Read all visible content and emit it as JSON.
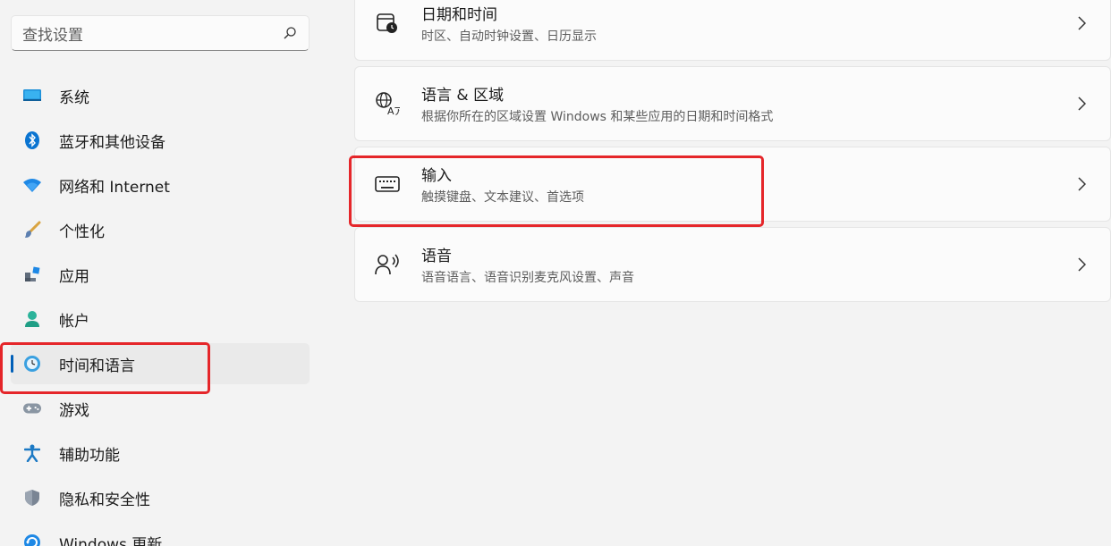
{
  "search": {
    "placeholder": "查找设置",
    "icon": "search-icon"
  },
  "sidebar": {
    "items": [
      {
        "label": "系统",
        "icon": "system-icon"
      },
      {
        "label": "蓝牙和其他设备",
        "icon": "bluetooth-icon"
      },
      {
        "label": "网络和 Internet",
        "icon": "wifi-icon"
      },
      {
        "label": "个性化",
        "icon": "brush-icon"
      },
      {
        "label": "应用",
        "icon": "apps-icon"
      },
      {
        "label": "帐户",
        "icon": "account-icon"
      },
      {
        "label": "时间和语言",
        "icon": "time-language-icon",
        "active": true
      },
      {
        "label": "游戏",
        "icon": "gamepad-icon"
      },
      {
        "label": "辅助功能",
        "icon": "accessibility-icon"
      },
      {
        "label": "隐私和安全性",
        "icon": "shield-icon"
      },
      {
        "label": "Windows 更新",
        "icon": "update-icon"
      }
    ]
  },
  "main": {
    "cards": [
      {
        "title": "日期和时间",
        "subtitle": "时区、自动时钟设置、日历显示",
        "icon": "calendar-clock-icon"
      },
      {
        "title": "语言 & 区域",
        "subtitle": "根据你所在的区域设置 Windows 和某些应用的日期和时间格式",
        "icon": "language-icon"
      },
      {
        "title": "输入",
        "subtitle": "触摸键盘、文本建议、首选项",
        "icon": "keyboard-icon"
      },
      {
        "title": "语音",
        "subtitle": "语音语言、语音识别麦克风设置、声音",
        "icon": "speech-icon"
      }
    ]
  },
  "colors": {
    "accent": "#005fb8",
    "highlight": "#e5262a"
  }
}
